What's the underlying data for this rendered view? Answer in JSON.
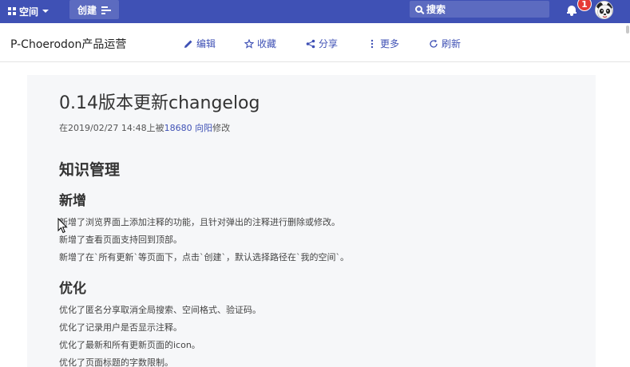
{
  "topbar": {
    "space_label": "空间",
    "create_label": "创建",
    "search_placeholder": "搜索",
    "notification_count": "1",
    "colors": {
      "bar": "#3f51b5",
      "button": "#5c6bc0",
      "badge": "#e53935"
    }
  },
  "subbar": {
    "space_title": "P-Choerodon产品运营",
    "actions": {
      "edit": "编辑",
      "favorite": "收藏",
      "share": "分享",
      "more": "更多",
      "refresh": "刷新"
    }
  },
  "document": {
    "title": "0.14版本更新changelog",
    "meta_prefix": "在2019/02/27 14:48上被",
    "meta_user": "18680 向阳",
    "meta_suffix": "修改",
    "section": "知识管理",
    "groups": [
      {
        "heading": "新增",
        "lines": [
          "新增了浏览界面上添加注释的功能，且针对弹出的注释进行删除或修改。",
          "新增了查看页面支持回到顶部。",
          "新增了在`所有更新`等页面下，点击`创建`，默认选择路径在`我的空间`。"
        ]
      },
      {
        "heading": "优化",
        "lines": [
          "优化了匿名分享取消全局搜索、空间格式、验证码。",
          "优化了记录用户是否显示注释。",
          "优化了最新和所有更新页面的icon。",
          "优化了页面标题的字数限制。"
        ]
      }
    ]
  }
}
